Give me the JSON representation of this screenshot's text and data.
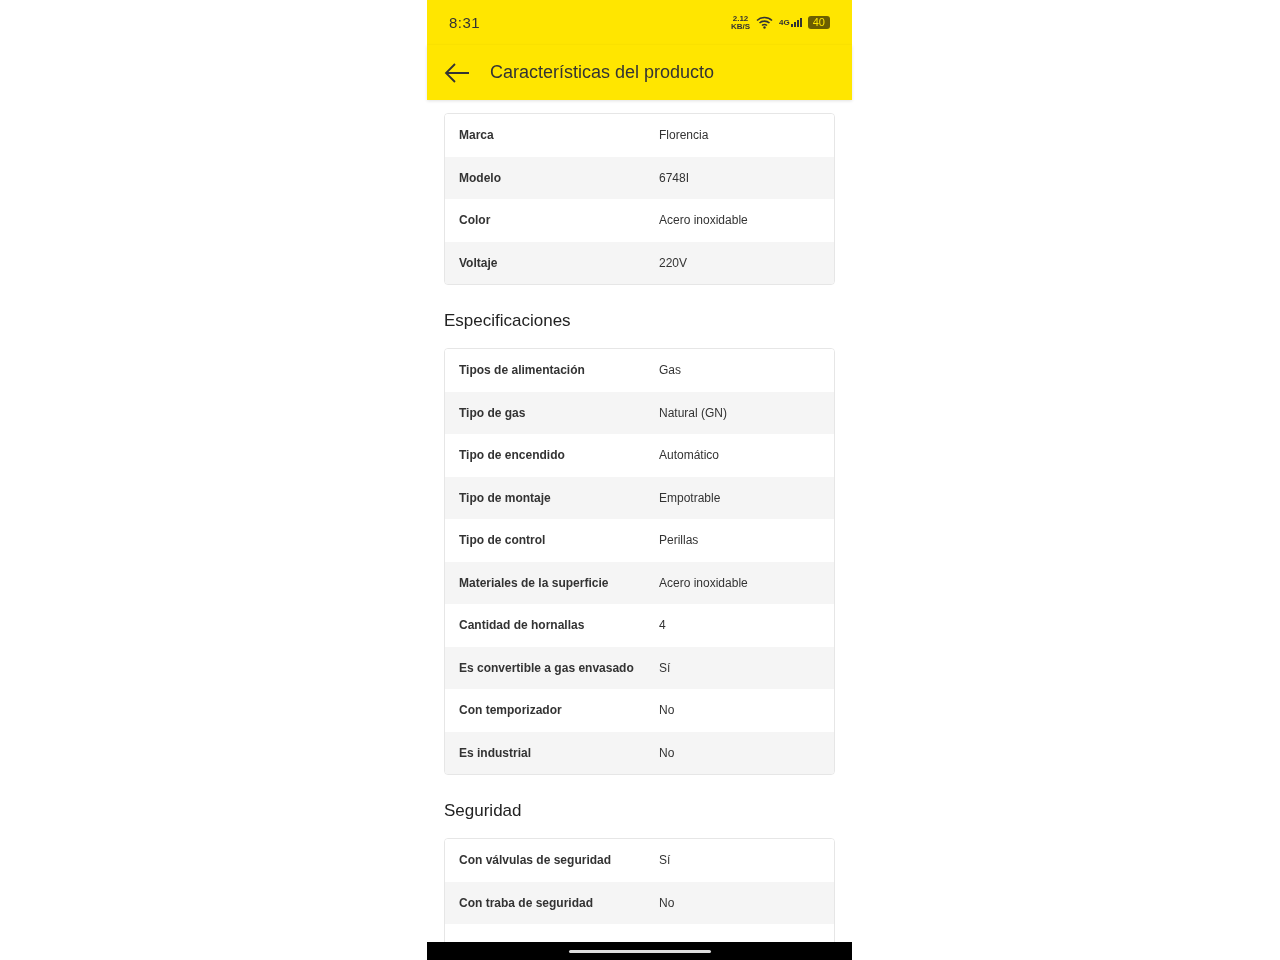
{
  "status_bar": {
    "time": "8:31",
    "speed": "2.12",
    "speed_unit": "KB/S",
    "network": "4G",
    "battery": "40"
  },
  "app_bar": {
    "title": "Características del producto"
  },
  "sections": [
    {
      "rows": [
        {
          "label": "Marca",
          "value": "Florencia"
        },
        {
          "label": "Modelo",
          "value": "6748I"
        },
        {
          "label": "Color",
          "value": "Acero inoxidable"
        },
        {
          "label": "Voltaje",
          "value": "220V"
        }
      ]
    },
    {
      "title": "Especificaciones",
      "rows": [
        {
          "label": "Tipos de alimentación",
          "value": "Gas"
        },
        {
          "label": "Tipo de gas",
          "value": "Natural (GN)"
        },
        {
          "label": "Tipo de encendido",
          "value": "Automático"
        },
        {
          "label": "Tipo de montaje",
          "value": "Empotrable"
        },
        {
          "label": "Tipo de control",
          "value": "Perillas"
        },
        {
          "label": "Materiales de la superficie",
          "value": "Acero inoxidable"
        },
        {
          "label": "Cantidad de hornallas",
          "value": "4"
        },
        {
          "label": "Es convertible a gas envasado",
          "value": "Sí"
        },
        {
          "label": "Con temporizador",
          "value": "No"
        },
        {
          "label": "Es industrial",
          "value": "No"
        }
      ]
    },
    {
      "title": "Seguridad",
      "rows": [
        {
          "label": "Con válvulas de seguridad",
          "value": "Sí"
        },
        {
          "label": "Con traba de seguridad",
          "value": "No"
        },
        {}
      ]
    }
  ]
}
